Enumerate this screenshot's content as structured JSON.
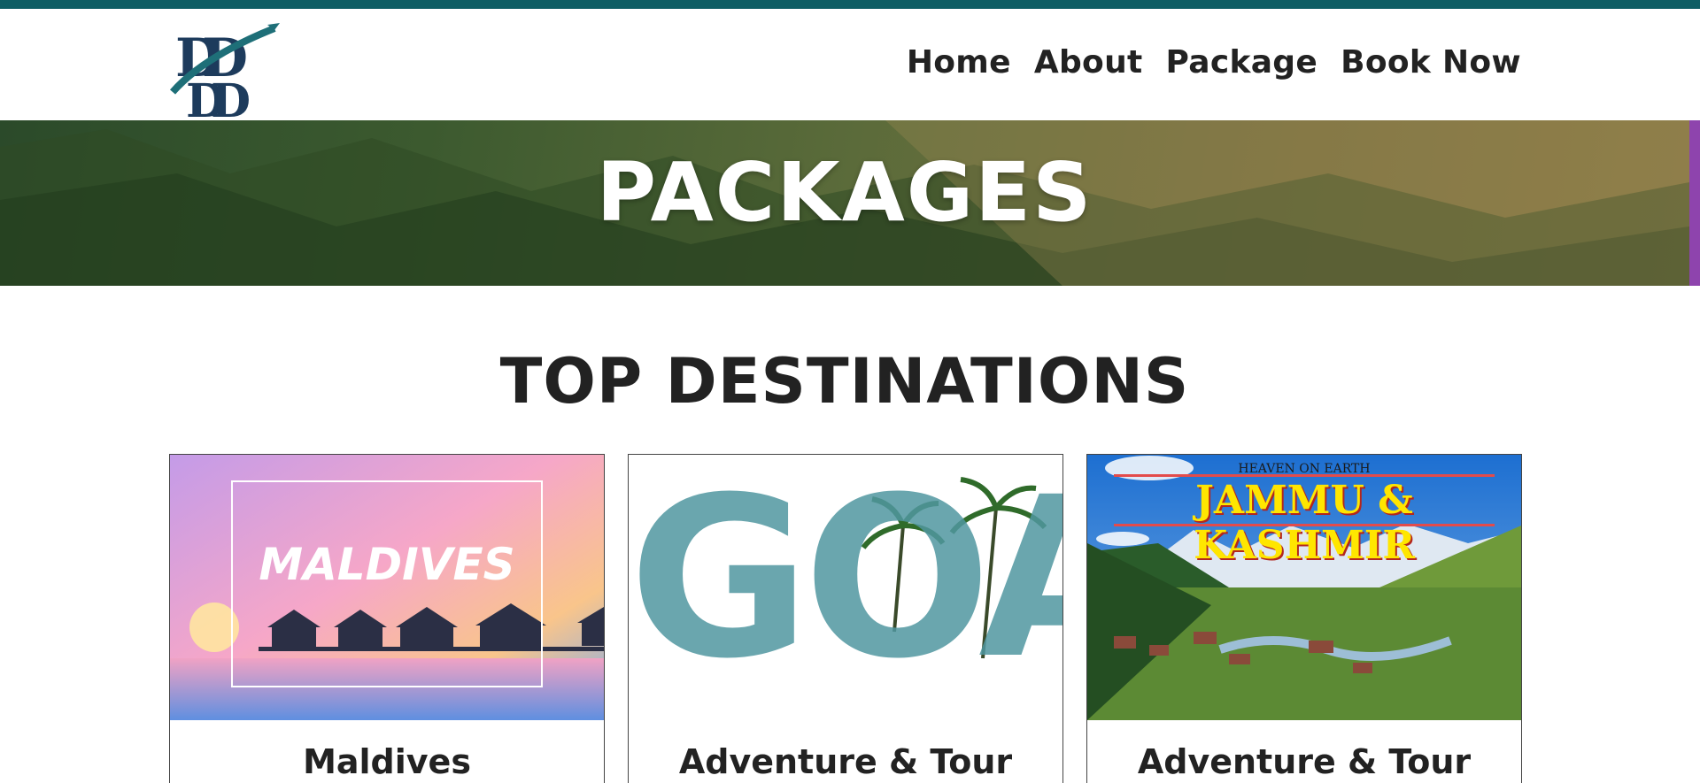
{
  "header": {
    "logo_alt": "DD logo",
    "nav": [
      {
        "label": "Home"
      },
      {
        "label": "About"
      },
      {
        "label": "Package"
      },
      {
        "label": "Book Now"
      }
    ]
  },
  "hero": {
    "title": "PACKAGES"
  },
  "section": {
    "title": "TOP DESTINATIONS"
  },
  "cards": [
    {
      "caption": "Maldives",
      "image_text": "MALDIVES"
    },
    {
      "caption": "Adventure & Tour",
      "image_text": "GOA"
    },
    {
      "caption": "Adventure & Tour",
      "image_text_top": "HEAVEN ON EARTH",
      "image_text": "JAMMU & KASHMIR"
    }
  ],
  "colors": {
    "topbar": "#0e5d64",
    "accent": "#8e44ad",
    "text": "#222222"
  }
}
